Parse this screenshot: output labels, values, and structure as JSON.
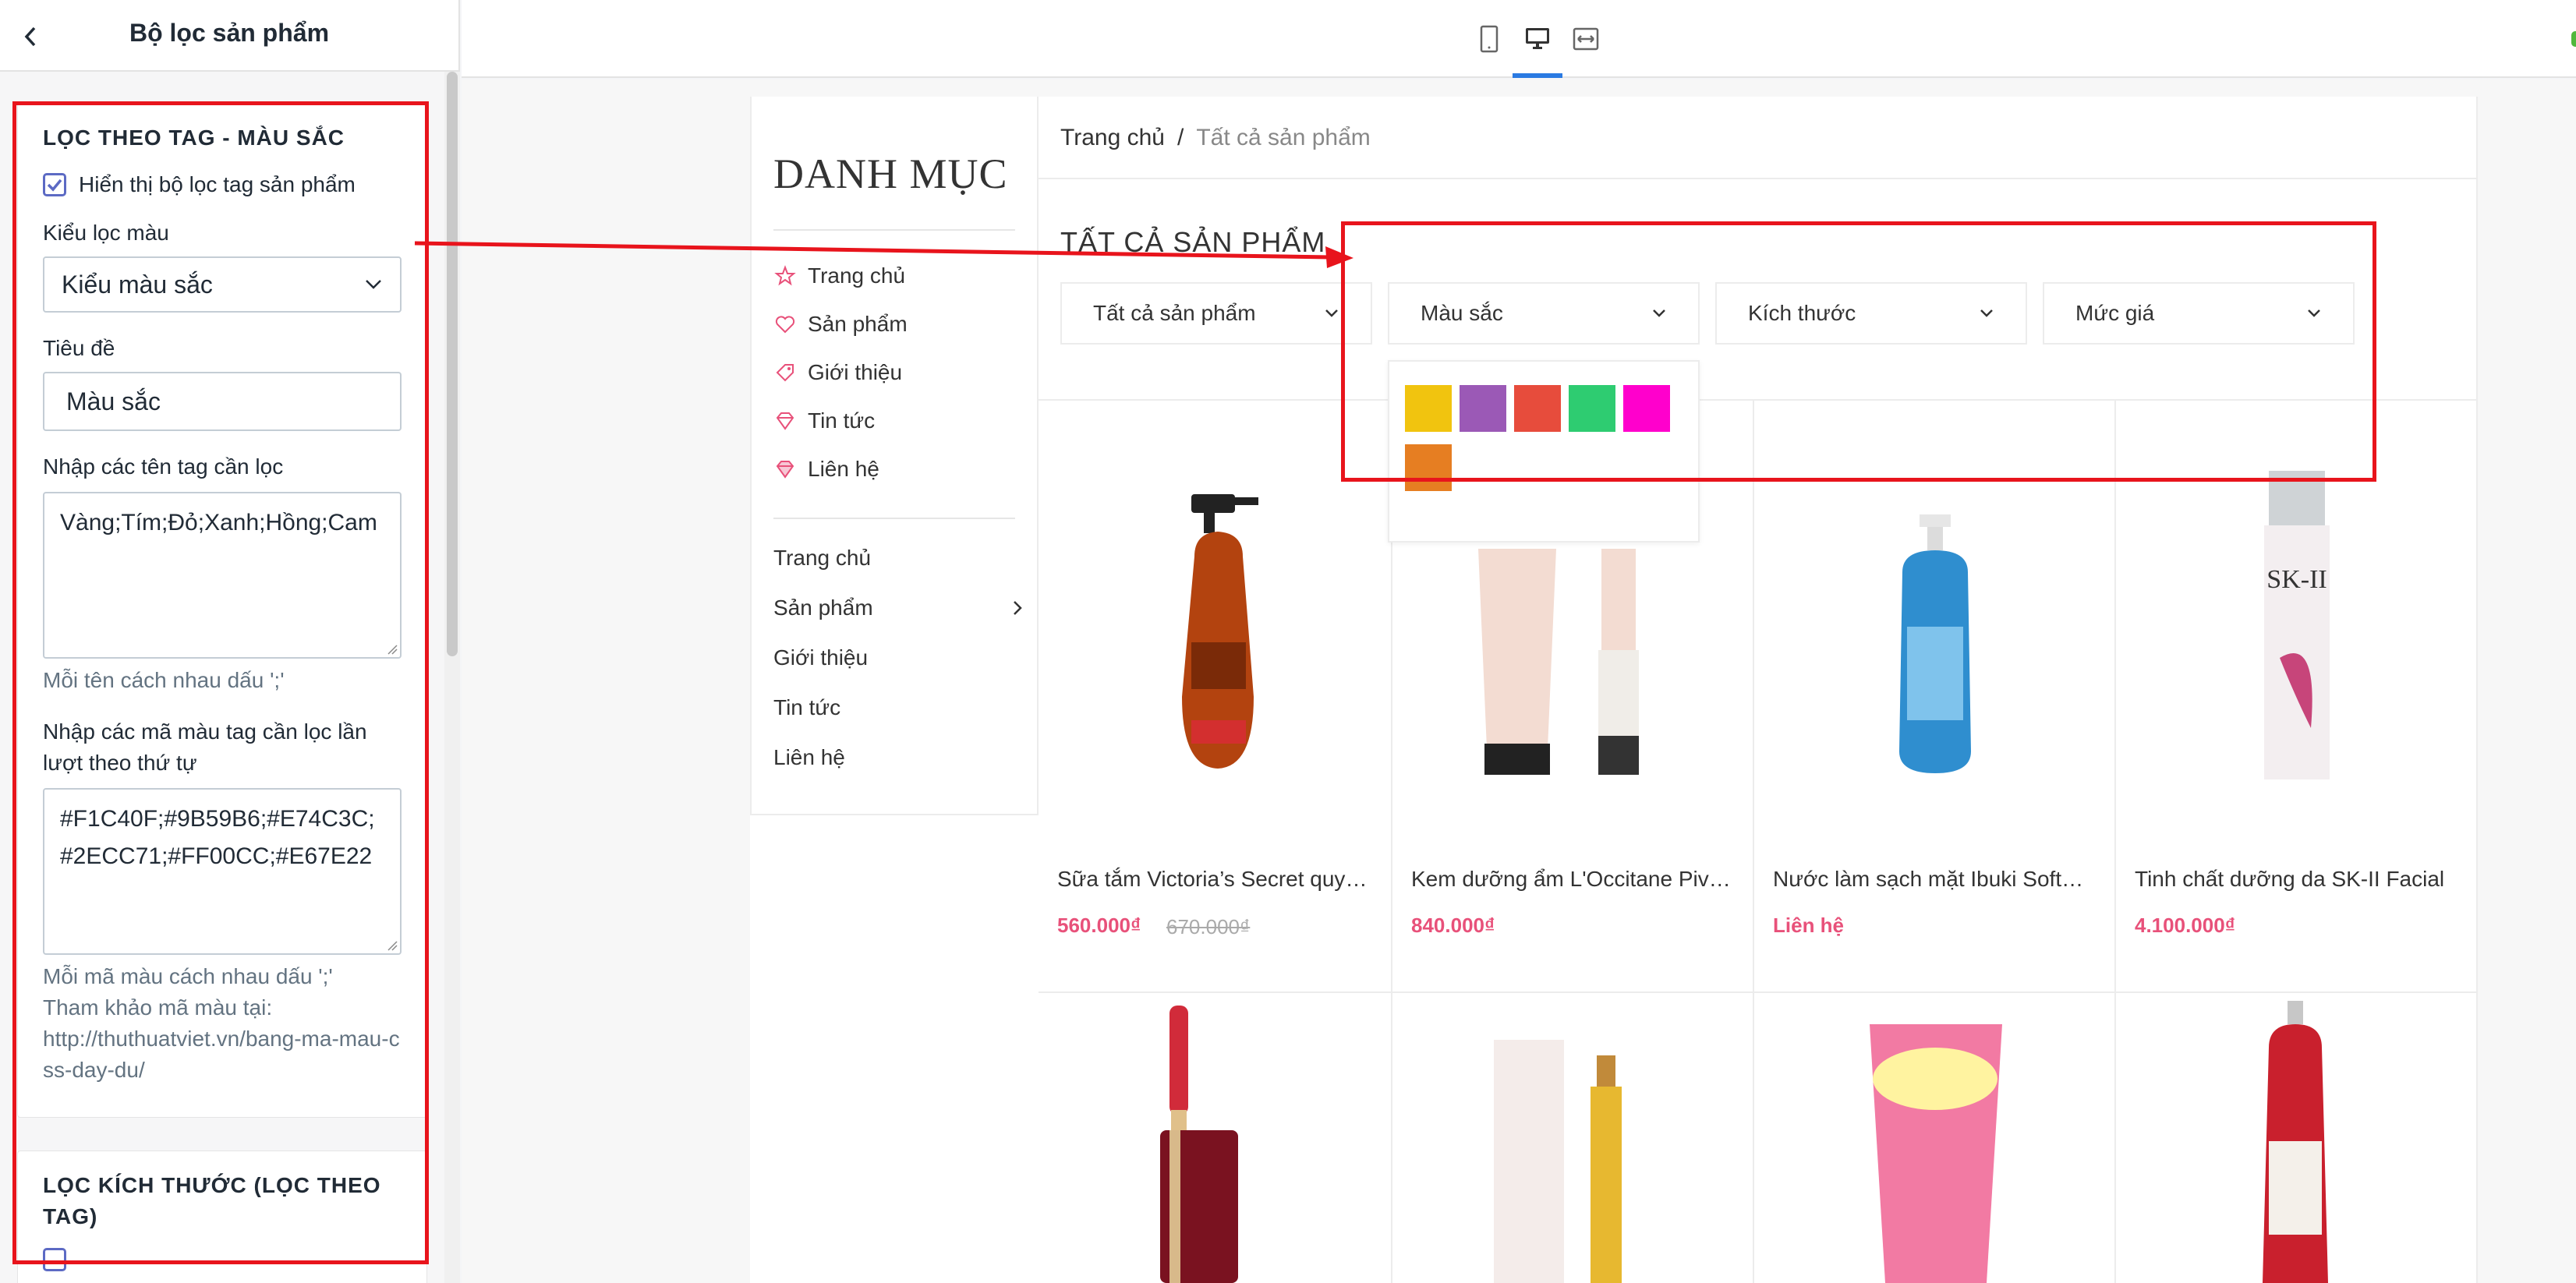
{
  "panel": {
    "title": "Bộ lọc sản phẩm",
    "section1": {
      "title": "LỌC THEO TAG - MÀU SẮC",
      "show_filter_label": "Hiển thị bộ lọc tag sản phẩm",
      "show_filter_checked": true,
      "filter_type_label": "Kiểu lọc màu",
      "filter_type_value": "Kiểu màu sắc",
      "title_label": "Tiêu đề",
      "title_value": "Màu sắc",
      "tags_label": "Nhập các tên tag cần lọc",
      "tags_value": "Vàng;Tím;Đỏ;Xanh;Hồng;Cam",
      "tags_help": "Mỗi tên cách nhau dấu ';'",
      "colors_label": "Nhập các mã màu tag cần lọc lần lượt theo thứ tự",
      "colors_value": "#F1C40F;#9B59B6;#E74C3C;#2ECC71;#FF00CC;#E67E22",
      "colors_help1": "Mỗi mã màu cách nhau dấu ';'",
      "colors_help2": "Tham khảo mã màu tại:",
      "colors_help3": "http://thuthuatviet.vn/bang-ma-mau-css-day-du/"
    },
    "section2": {
      "title": "LỌC KÍCH THƯỚC (LỌC THEO TAG)"
    }
  },
  "toolbar": {
    "devices": [
      "mobile-icon",
      "desktop-icon",
      "fullwidth-icon"
    ],
    "active_device": "desktop",
    "accent": "#2a7ae2"
  },
  "store": {
    "sidebar": {
      "title": "DANH MỤC",
      "icon_nav": [
        {
          "label": "Trang chủ",
          "icon": "star-icon"
        },
        {
          "label": "Sản phẩm",
          "icon": "heart-icon"
        },
        {
          "label": "Giới thiệu",
          "icon": "tag-icon"
        },
        {
          "label": "Tin tức",
          "icon": "diamond-icon"
        },
        {
          "label": "Liên hệ",
          "icon": "diamond-icon"
        }
      ],
      "menu": [
        {
          "label": "Trang chủ"
        },
        {
          "label": "Sản phẩm",
          "has_children": true
        },
        {
          "label": "Giới thiệu"
        },
        {
          "label": "Tin tức"
        },
        {
          "label": "Liên hệ"
        }
      ]
    },
    "breadcrumb": {
      "home": "Trang chủ",
      "sep": "/",
      "current": "Tất cả sản phẩm"
    },
    "heading": "TẤT CẢ SẢN PHẨM",
    "filters": [
      {
        "label": "Tất cả sản phẩm"
      },
      {
        "label": "Màu sắc"
      },
      {
        "label": "Kích thước"
      },
      {
        "label": "Mức giá"
      }
    ],
    "swatches": [
      "#F1C40F",
      "#9B59B6",
      "#E74C3C",
      "#2ECC71",
      "#FF00CC",
      "#E67E22"
    ],
    "products": [
      {
        "name": "Sữa tắm Victoria’s Secret quyến rũ",
        "price": "560.000₫",
        "old_price": "670.000₫"
      },
      {
        "name": "Kem dưỡng ẩm L'Occitane Pivoine",
        "price": "840.000₫",
        "old_price": ""
      },
      {
        "name": "Nước làm sạch mặt Ibuki Softening",
        "price": "Liên hệ",
        "old_price": ""
      },
      {
        "name": "Tinh chất dưỡng da SK-II Facial",
        "price": "4.100.000₫",
        "old_price": ""
      }
    ],
    "price_color": "#e8517a"
  },
  "annotation": {
    "color": "#e8141c"
  }
}
